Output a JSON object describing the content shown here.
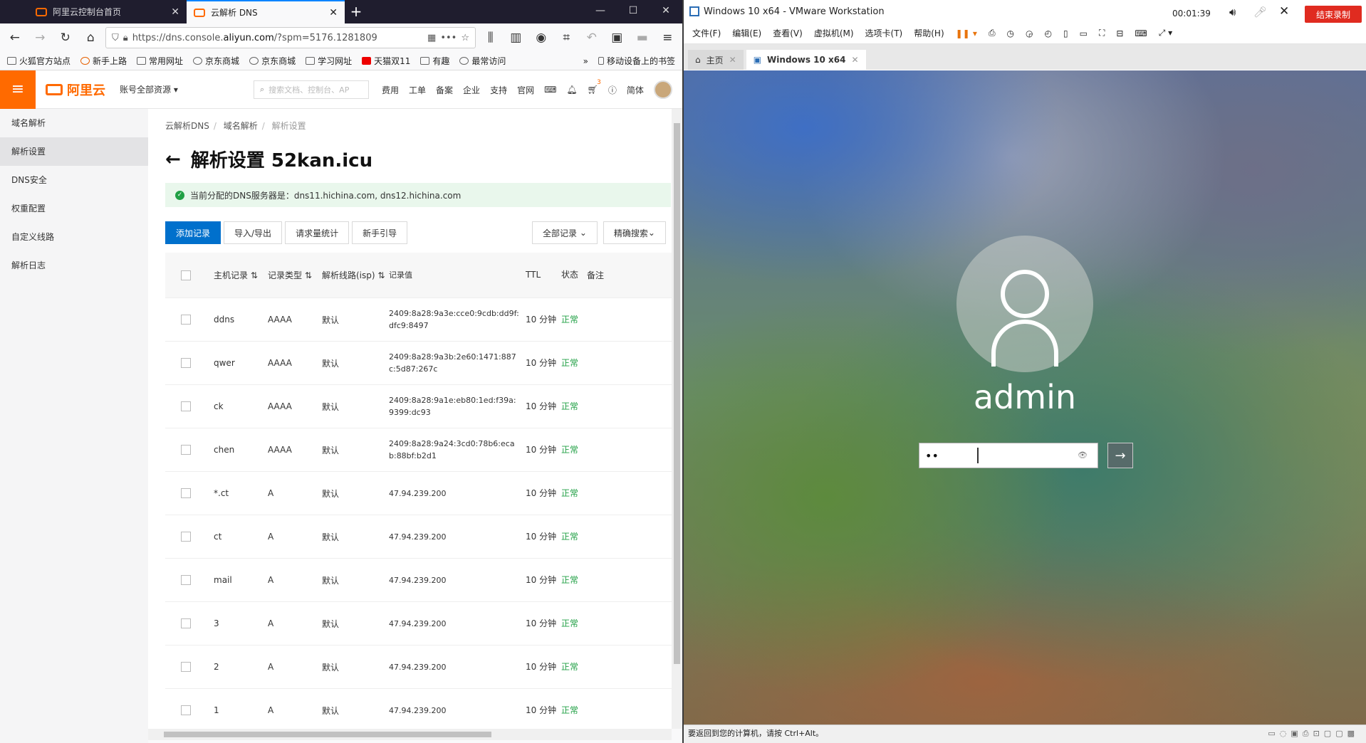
{
  "browser": {
    "tabs": [
      {
        "label": "阿里云控制台首页"
      },
      {
        "label": "云解析 DNS"
      }
    ],
    "url_prefix": "https://dns.console.",
    "url_host": "aliyun.com",
    "url_rest": "/?spm=5176.1281809",
    "bookmarks": [
      "火狐官方站点",
      "新手上路",
      "常用网址",
      "京东商城",
      "京东商城",
      "学习网址",
      "天猫双11",
      "有趣",
      "最常访问"
    ],
    "mobile_bookmarks": "移动设备上的书签"
  },
  "console": {
    "brand": "阿里云",
    "account": "账号全部资源",
    "search_placeholder": "搜索文档、控制台、AP",
    "nav": [
      "费用",
      "工单",
      "备案",
      "企业",
      "支持",
      "官网"
    ],
    "cart_badge": "3",
    "lang": "简体"
  },
  "sidebar": {
    "items": [
      "域名解析",
      "解析设置",
      "DNS安全",
      "权重配置",
      "自定义线路",
      "解析日志"
    ]
  },
  "breadcrumb": [
    "云解析DNS",
    "域名解析",
    "解析设置"
  ],
  "page_title": "解析设置 52kan.icu",
  "notice": "当前分配的DNS服务器是：dns11.hichina.com, dns12.hichina.com",
  "actions": {
    "add": "添加记录",
    "import": "导入/导出",
    "stats": "请求量统计",
    "guide": "新手引导",
    "filter": "全部记录",
    "search": "精确搜索"
  },
  "table": {
    "headers": {
      "host": "主机记录",
      "type": "记录类型",
      "line": "解析线路(isp)",
      "value": "记录值",
      "ttl": "TTL",
      "status": "状态",
      "note": "备注"
    },
    "rows": [
      {
        "host": "ddns",
        "type": "AAAA",
        "line": "默认",
        "value": "2409:8a28:9a3e:cce0:9cdb:dd9f:dfc9:8497",
        "ttl": "10 分钟",
        "status": "正常"
      },
      {
        "host": "qwer",
        "type": "AAAA",
        "line": "默认",
        "value": "2409:8a28:9a3b:2e60:1471:887c:5d87:267c",
        "ttl": "10 分钟",
        "status": "正常"
      },
      {
        "host": "ck",
        "type": "AAAA",
        "line": "默认",
        "value": "2409:8a28:9a1e:eb80:1ed:f39a:9399:dc93",
        "ttl": "10 分钟",
        "status": "正常"
      },
      {
        "host": "chen",
        "type": "AAAA",
        "line": "默认",
        "value": "2409:8a28:9a24:3cd0:78b6:ecab:88bf:b2d1",
        "ttl": "10 分钟",
        "status": "正常"
      },
      {
        "host": "*.ct",
        "type": "A",
        "line": "默认",
        "value": "47.94.239.200",
        "ttl": "10 分钟",
        "status": "正常"
      },
      {
        "host": "ct",
        "type": "A",
        "line": "默认",
        "value": "47.94.239.200",
        "ttl": "10 分钟",
        "status": "正常"
      },
      {
        "host": "mail",
        "type": "A",
        "line": "默认",
        "value": "47.94.239.200",
        "ttl": "10 分钟",
        "status": "正常"
      },
      {
        "host": "3",
        "type": "A",
        "line": "默认",
        "value": "47.94.239.200",
        "ttl": "10 分钟",
        "status": "正常"
      },
      {
        "host": "2",
        "type": "A",
        "line": "默认",
        "value": "47.94.239.200",
        "ttl": "10 分钟",
        "status": "正常"
      },
      {
        "host": "1",
        "type": "A",
        "line": "默认",
        "value": "47.94.239.200",
        "ttl": "10 分钟",
        "status": "正常"
      }
    ]
  },
  "vmware": {
    "title": "Windows 10 x64 - VMware Workstation",
    "timer": "00:01:39",
    "end_record": "结束录制",
    "menu": [
      "文件(F)",
      "编辑(E)",
      "查看(V)",
      "虚拟机(M)",
      "选项卡(T)",
      "帮助(H)"
    ],
    "tabs": [
      "主页",
      "Windows 10 x64"
    ],
    "status_text": "要返回到您的计算机，请按 Ctrl+Alt。"
  },
  "login": {
    "username": "admin",
    "password_mask": "••"
  },
  "colors": {
    "accent": "#ff6a00",
    "primary": "#0070cc",
    "ok": "#21a045",
    "end_record": "#e02b20"
  }
}
